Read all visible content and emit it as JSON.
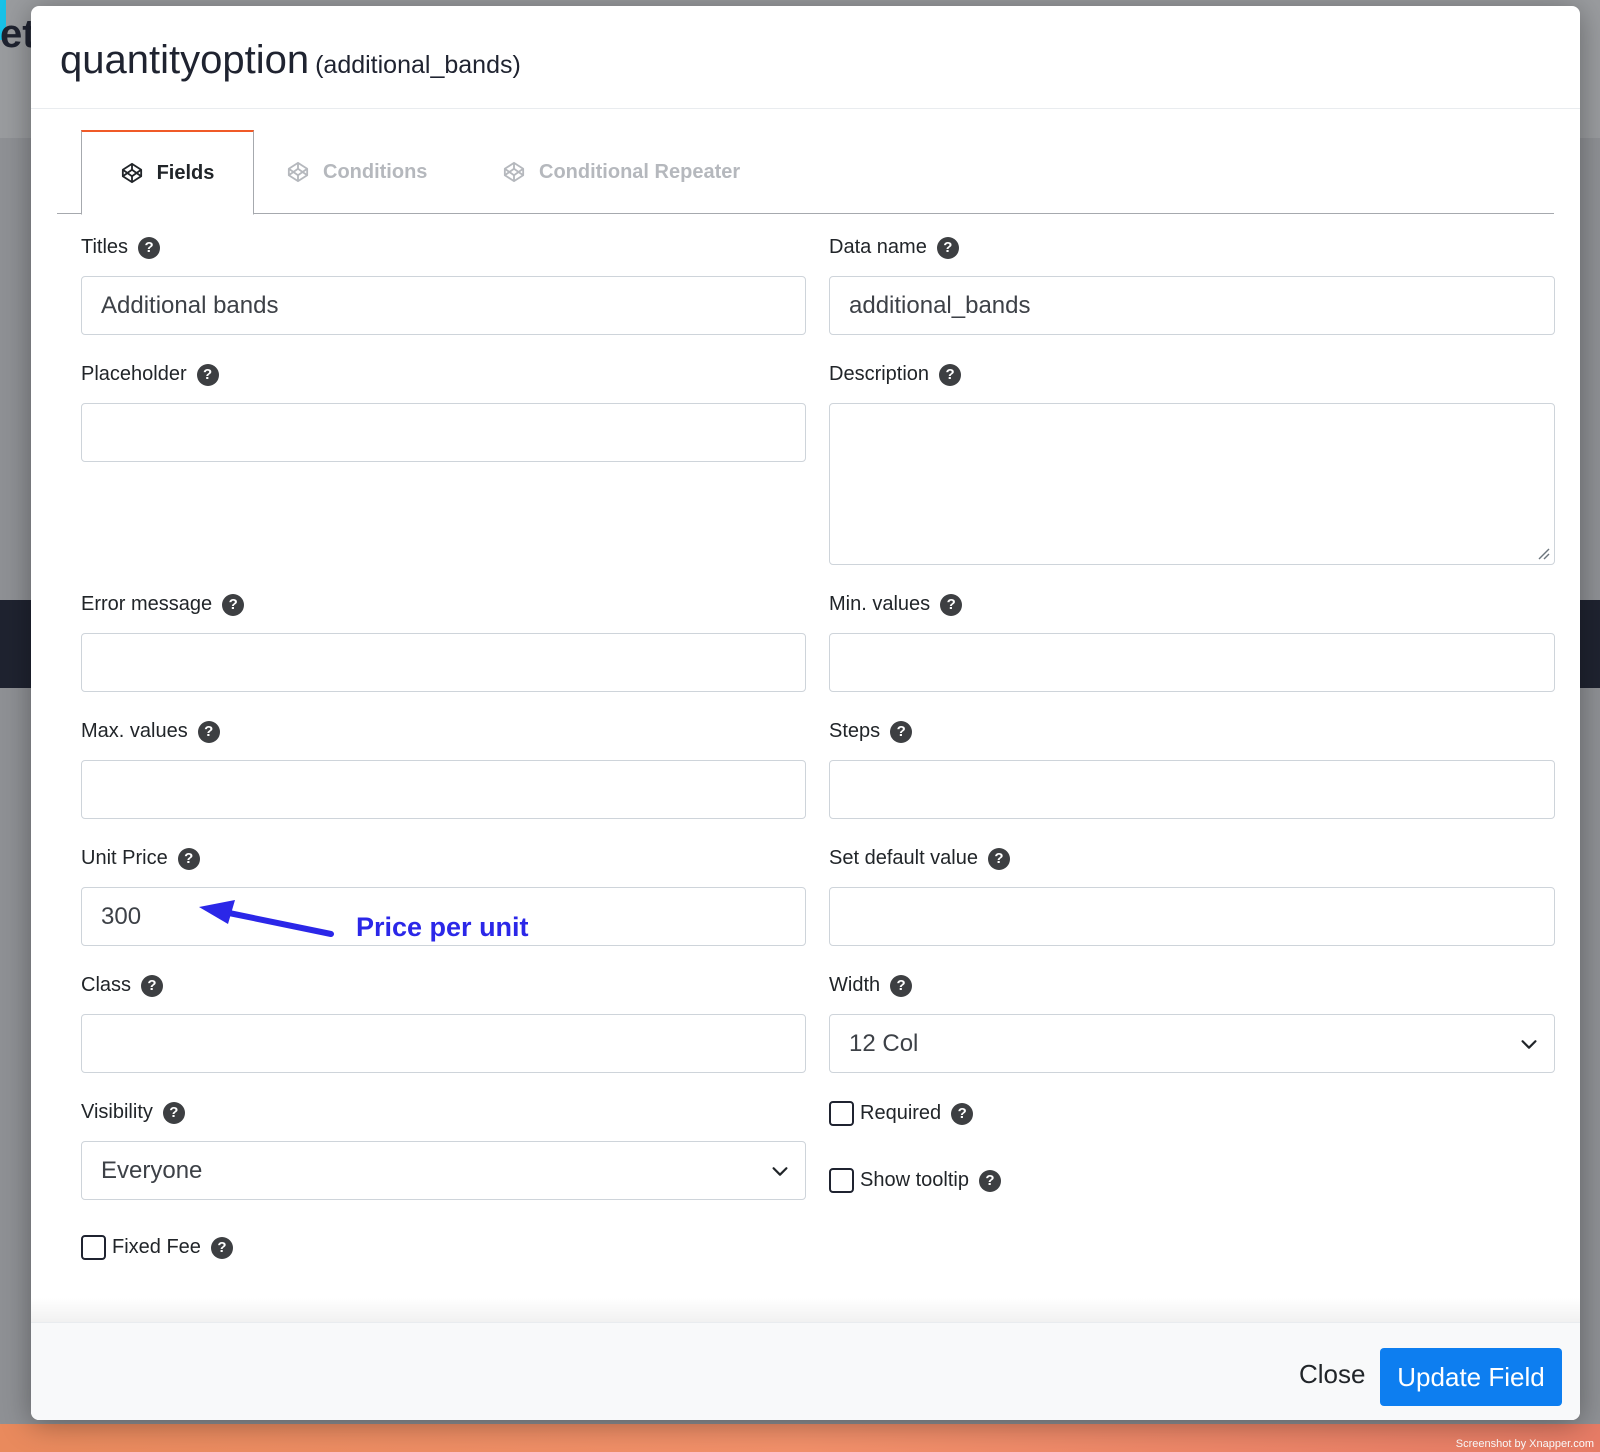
{
  "background": {
    "partial_title": "et",
    "credit": "Screenshot by Xnapper.com"
  },
  "modal": {
    "title": "quantityoption",
    "subtitle": "(additional_bands)"
  },
  "tabs": [
    {
      "label": "Fields",
      "icon": "codepen-icon",
      "active": true
    },
    {
      "label": "Conditions",
      "icon": "codepen-icon",
      "active": false
    },
    {
      "label": "Conditional Repeater",
      "icon": "codepen-icon",
      "active": false
    }
  ],
  "fields": {
    "titles": {
      "label": "Titles",
      "value": "Additional bands"
    },
    "data_name": {
      "label": "Data name",
      "value": "additional_bands"
    },
    "placeholder": {
      "label": "Placeholder",
      "value": ""
    },
    "description": {
      "label": "Description",
      "value": ""
    },
    "error_message": {
      "label": "Error message",
      "value": ""
    },
    "min_values": {
      "label": "Min. values",
      "value": ""
    },
    "max_values": {
      "label": "Max. values",
      "value": ""
    },
    "steps": {
      "label": "Steps",
      "value": ""
    },
    "unit_price": {
      "label": "Unit Price",
      "value": "300"
    },
    "default_value": {
      "label": "Set default value",
      "value": ""
    },
    "class": {
      "label": "Class",
      "value": ""
    },
    "width": {
      "label": "Width",
      "value": "12 Col"
    },
    "visibility": {
      "label": "Visibility",
      "value": "Everyone"
    },
    "required": {
      "label": "Required",
      "checked": false
    },
    "show_tooltip": {
      "label": "Show tooltip",
      "checked": false
    },
    "fixed_fee": {
      "label": "Fixed Fee",
      "checked": false
    }
  },
  "help_glyph": "?",
  "annotation": {
    "text": "Price per unit",
    "color": "#2b27e8"
  },
  "footer": {
    "close_label": "Close",
    "update_label": "Update Field"
  },
  "colors": {
    "primary": "#0d7ef0",
    "tab_accent": "#f05a28"
  }
}
